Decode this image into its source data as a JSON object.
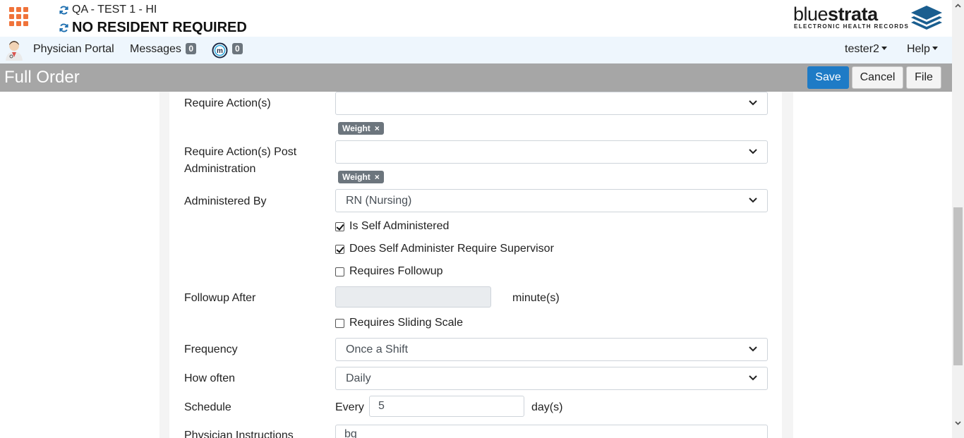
{
  "header": {
    "facility": "QA - TEST 1 - HI",
    "resident": "NO RESIDENT REQUIRED",
    "brand_light": "blue",
    "brand_bold": "strata",
    "brand_tagline": "ELECTRONIC HEALTH RECORDS",
    "accent_color": "#f0733a"
  },
  "nav": {
    "physician_portal": "Physician Portal",
    "messages": "Messages",
    "messages_count": "0",
    "m_count": "0",
    "user": "tester2",
    "help": "Help"
  },
  "titlebar": {
    "title": "Full Order",
    "save": "Save",
    "cancel": "Cancel",
    "file": "File",
    "save_color": "#1e7bc6"
  },
  "form": {
    "require_actions": {
      "label": "Require Action(s)",
      "value": "",
      "tag": "Weight"
    },
    "require_actions_post": {
      "label": "Require Action(s) Post Administration",
      "value": "",
      "tag": "Weight"
    },
    "administered_by": {
      "label": "Administered By",
      "value": "RN (Nursing)"
    },
    "is_self_administered": {
      "label": "Is Self Administered",
      "checked": true
    },
    "self_admin_supervisor": {
      "label": "Does Self Administer Require Supervisor",
      "checked": true
    },
    "requires_followup": {
      "label": "Requires Followup",
      "checked": false
    },
    "followup_after": {
      "label": "Followup After",
      "value": "",
      "unit": "minute(s)"
    },
    "requires_sliding_scale": {
      "label": "Requires Sliding Scale",
      "checked": false
    },
    "frequency": {
      "label": "Frequency",
      "value": "Once a Shift"
    },
    "how_often": {
      "label": "How often",
      "value": "Daily"
    },
    "schedule": {
      "label": "Schedule",
      "prefix": "Every",
      "value": "5",
      "unit": "day(s)"
    },
    "physician_instructions": {
      "label": "Physician Instructions",
      "value": "bg"
    }
  },
  "tag_remove": "×"
}
